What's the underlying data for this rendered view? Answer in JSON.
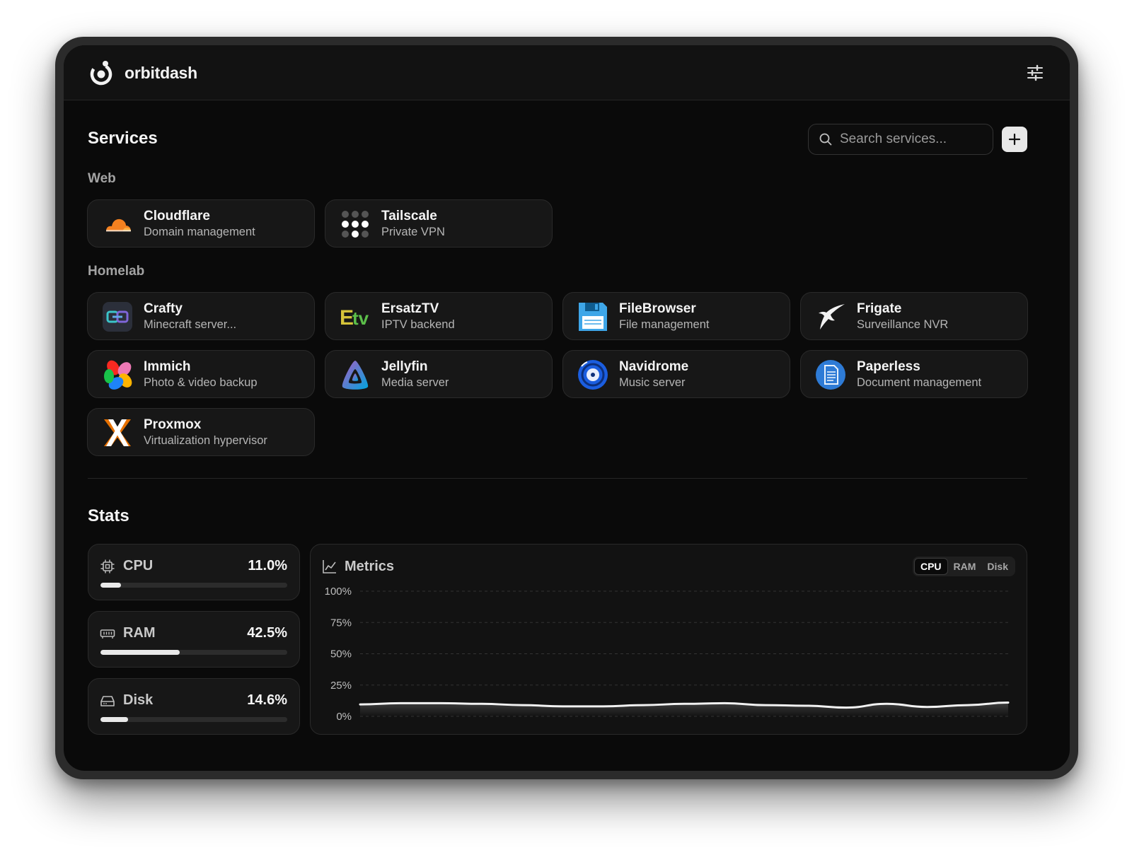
{
  "app": {
    "name": "orbitdash"
  },
  "services": {
    "title": "Services",
    "search_placeholder": "Search services...",
    "groups": [
      {
        "title": "Web",
        "items": [
          {
            "name": "Cloudflare",
            "desc": "Domain management",
            "icon": "cloudflare-icon"
          },
          {
            "name": "Tailscale",
            "desc": "Private VPN",
            "icon": "tailscale-icon"
          }
        ]
      },
      {
        "title": "Homelab",
        "items": [
          {
            "name": "Crafty",
            "desc": "Minecraft server...",
            "icon": "crafty-icon"
          },
          {
            "name": "ErsatzTV",
            "desc": "IPTV backend",
            "icon": "ersatztv-icon"
          },
          {
            "name": "FileBrowser",
            "desc": "File management",
            "icon": "filebrowser-icon"
          },
          {
            "name": "Frigate",
            "desc": "Surveillance NVR",
            "icon": "frigate-icon"
          },
          {
            "name": "Immich",
            "desc": "Photo & video backup",
            "icon": "immich-icon"
          },
          {
            "name": "Jellyfin",
            "desc": "Media server",
            "icon": "jellyfin-icon"
          },
          {
            "name": "Navidrome",
            "desc": "Music server",
            "icon": "navidrome-icon"
          },
          {
            "name": "Paperless",
            "desc": "Document management",
            "icon": "paperless-icon"
          },
          {
            "name": "Proxmox",
            "desc": "Virtualization hypervisor",
            "icon": "proxmox-icon"
          }
        ]
      }
    ]
  },
  "stats": {
    "title": "Stats",
    "items": [
      {
        "label": "CPU",
        "value": "11.0%",
        "percent": 11.0,
        "icon": "cpu-icon"
      },
      {
        "label": "RAM",
        "value": "42.5%",
        "percent": 42.5,
        "icon": "ram-icon"
      },
      {
        "label": "Disk",
        "value": "14.6%",
        "percent": 14.6,
        "icon": "disk-icon"
      }
    ]
  },
  "metrics": {
    "title": "Metrics",
    "tabs": [
      "CPU",
      "RAM",
      "Disk"
    ],
    "active_tab": "CPU"
  },
  "chart_data": {
    "type": "area",
    "title": "",
    "xlabel": "",
    "ylabel": "",
    "ylim": [
      0,
      100
    ],
    "yticks": [
      "100%",
      "75%",
      "50%",
      "25%",
      "0%"
    ],
    "grid": true,
    "series": [
      {
        "values": [
          9.5,
          10.5,
          10.5,
          10,
          9,
          8,
          8,
          9,
          10,
          10.5,
          9,
          8.5,
          7,
          10,
          7.5,
          9,
          11
        ]
      }
    ]
  },
  "colors": {
    "background": "#0a0a0a",
    "card": "#171717",
    "accent": "#e9e9e9"
  }
}
